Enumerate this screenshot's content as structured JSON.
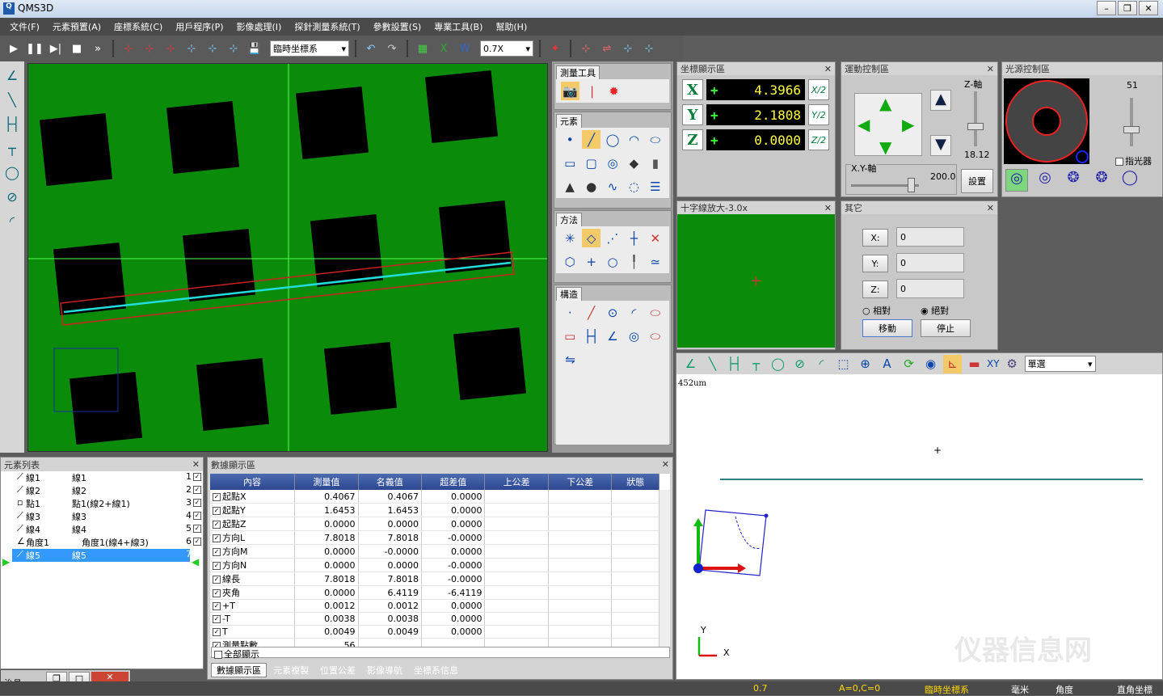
{
  "app": {
    "title": "QMS3D"
  },
  "menu": [
    "文件(F)",
    "元素預置(A)",
    "座標系統(C)",
    "用戶程序(P)",
    "影像處理(I)",
    "探針測量系統(T)",
    "參數設置(S)",
    "專業工具(B)",
    "幫助(H)"
  ],
  "toolbar": {
    "coord_combo": "臨時坐標系",
    "zoom_combo": "0.7X"
  },
  "tool_panel": {
    "title": "測量工具",
    "sections": {
      "elements": "元素",
      "methods": "方法",
      "construct": "構造"
    }
  },
  "coord_panel": {
    "title": "坐標顯示區",
    "x": {
      "axis": "X",
      "value": "4.3966"
    },
    "y": {
      "axis": "Y",
      "value": "2.1808"
    },
    "z": {
      "axis": "Z",
      "value": "0.0000"
    },
    "sign": "+",
    "half_labels": [
      "X/2",
      "Y/2",
      "Z/2"
    ]
  },
  "motion_panel": {
    "title": "運動控制區",
    "z_axis_label": "Z-軸",
    "z_value": "18.12",
    "xy_axis_label": "X.Y-軸",
    "xy_value": "200.0",
    "settings_button": "設置"
  },
  "light_panel": {
    "title": "光源控制區",
    "level": "51",
    "indicator_label": "指光器"
  },
  "crosshair_panel": {
    "title": "十字線放大-3.0x"
  },
  "other_panel": {
    "title": "其它",
    "x_label": "X:",
    "y_label": "Y:",
    "z_label": "Z:",
    "x_value": "0",
    "y_value": "0",
    "z_value": "0",
    "relative_label": "相對",
    "absolute_label": "絕對",
    "move_button": "移動",
    "stop_button": "停止"
  },
  "graphics_panel": {
    "select_combo": "單選",
    "scale_label": "452um",
    "axis_y": "Y",
    "axis_x": "X",
    "xy_button": "XY"
  },
  "element_list": {
    "title": "元素列表",
    "items": [
      {
        "name": "線1",
        "desc": "線1",
        "num": "1"
      },
      {
        "name": "線2",
        "desc": "線2",
        "num": "2"
      },
      {
        "name": "點1",
        "desc": "點1(線2+線1)",
        "num": "3"
      },
      {
        "name": "線3",
        "desc": "線3",
        "num": "4"
      },
      {
        "name": "線4",
        "desc": "線4",
        "num": "5"
      },
      {
        "name": "角度1",
        "desc": "角度1(線4+線3)",
        "num": "6"
      },
      {
        "name": "線5",
        "desc": "線5",
        "num": "7"
      }
    ]
  },
  "data_panel": {
    "title": "數據顯示區",
    "columns": [
      "內容",
      "測量值",
      "名義值",
      "超差值",
      "上公差",
      "下公差",
      "狀態"
    ],
    "rows": [
      [
        "起點X",
        "0.4067",
        "0.4067",
        "0.0000"
      ],
      [
        "起點Y",
        "1.6453",
        "1.6453",
        "0.0000"
      ],
      [
        "起點Z",
        "0.0000",
        "0.0000",
        "0.0000"
      ],
      [
        "方向L",
        "7.8018",
        "7.8018",
        "-0.0000"
      ],
      [
        "方向M",
        "0.0000",
        "-0.0000",
        "0.0000"
      ],
      [
        "方向N",
        "0.0000",
        "0.0000",
        "-0.0000"
      ],
      [
        "線長",
        "7.8018",
        "7.8018",
        "-0.0000"
      ],
      [
        "夾角",
        "0.0000",
        "6.4119",
        "-6.4119"
      ],
      [
        "+T",
        "0.0012",
        "0.0012",
        "0.0000"
      ],
      [
        "-T",
        "0.0038",
        "0.0038",
        "0.0000"
      ],
      [
        "T",
        "0.0049",
        "0.0049",
        "0.0000"
      ],
      [
        "測量點數",
        "56",
        "",
        ""
      ]
    ],
    "show_all": "全部顯示",
    "tabs": [
      "數據顯示區",
      "元素複製",
      "位置公差",
      "影像導航",
      "坐標系信息"
    ]
  },
  "fixture_panel": {
    "title": "治具"
  },
  "statusbar": {
    "zoom": "0.7",
    "ac": "A=0,C=0",
    "coord": "臨時坐標系",
    "unit": "毫米",
    "angle": "角度",
    "system": "直角坐標"
  },
  "watermark": "仪器信息网",
  "colors": {
    "accent": "#0a8c0a",
    "readout": "#ffff3b",
    "header": "#2c4790"
  }
}
